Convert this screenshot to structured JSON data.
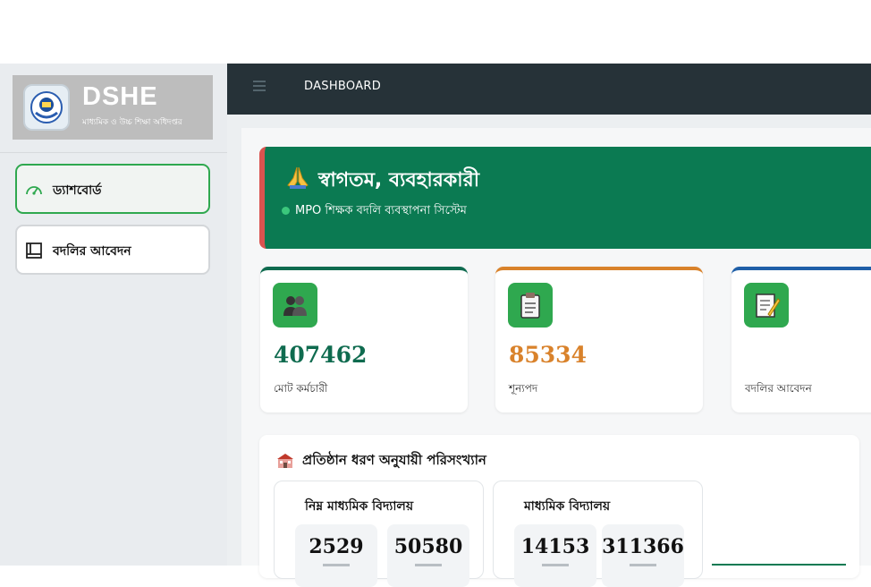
{
  "brand": {
    "title": "DSHE",
    "subtitle": "মাধ্যমিক ও উচ্চ শিক্ষা অধিদপ্তর"
  },
  "sidebar": {
    "items": [
      {
        "label": "ড্যাশবোর্ড",
        "icon": "gauge-icon",
        "active": true
      },
      {
        "label": "বদলির আবেদন",
        "icon": "book-icon",
        "active": false
      }
    ]
  },
  "topbar": {
    "title": "DASHBOARD",
    "menu_icon": "hamburger-icon"
  },
  "welcome": {
    "icon": "praying-hands-icon",
    "title": "স্বাগতম, ব্যবহারকারী",
    "subtitle": "MPO শিক্ষক বদলি ব্যবস্থাপনা সিস্টেম"
  },
  "stats": [
    {
      "value": "407462",
      "label": "মোট কর্মচারী",
      "icon": "people-icon",
      "color": "#0f6b4f"
    },
    {
      "value": "85334",
      "label": "শূন্যপদ",
      "icon": "clipboard-icon",
      "color": "#d9822b"
    },
    {
      "value": "",
      "label": "বদলির আবেদন",
      "icon": "memo-icon",
      "color": "#1f5fa8"
    }
  ],
  "institution_stats": {
    "icon": "school-icon",
    "title": "প্রতিষ্ঠান ধরণ অনুযায়ী পরিসংখ্যান",
    "groups": [
      {
        "title": "নিম্ন মাধ্যমিক বিদ্যালয়",
        "values": [
          "2529",
          "50580"
        ]
      },
      {
        "title": "মাধ্যমিক বিদ্যালয়",
        "values": [
          "14153",
          "311366"
        ]
      }
    ]
  },
  "colors": {
    "sidebar_bg": "#e9ecef",
    "topbar_bg": "#263238",
    "welcome_bg": "#0b7a52",
    "accent_green": "#2fa84f",
    "alert_red": "#d9534f"
  }
}
